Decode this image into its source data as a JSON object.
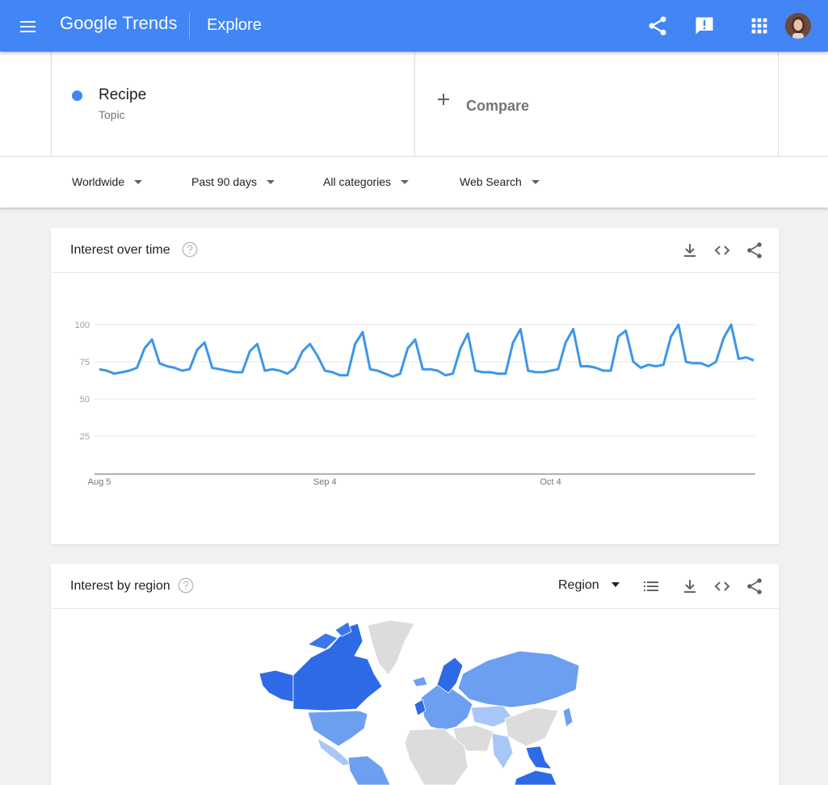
{
  "header": {
    "logo_google": "Google",
    "logo_trends": "Trends",
    "title": "Explore",
    "icons": [
      "menu-icon",
      "share-icon",
      "feedback-icon",
      "apps-icon",
      "avatar"
    ]
  },
  "search_terms": [
    {
      "name": "Recipe",
      "type": "Topic",
      "color": "#4285f4"
    }
  ],
  "compare": {
    "label": "Compare"
  },
  "filters": {
    "geo": "Worldwide",
    "time": "Past 90 days",
    "category": "All categories",
    "property": "Web Search"
  },
  "interest_over_time": {
    "title": "Interest over time"
  },
  "interest_by_region": {
    "title": "Interest by region",
    "resolution": "Region"
  },
  "colors": {
    "brand": "#4285f4",
    "line": "#3d96ea",
    "map_light": "#a8c7f8",
    "map_mid": "#6c9ff0",
    "map_dark": "#2f6ae6",
    "map_none": "#dcdcdc"
  },
  "chart_data": {
    "type": "line",
    "title": "",
    "xlabel": "",
    "ylabel": "",
    "ylim": [
      0,
      100
    ],
    "yticks": [
      25,
      50,
      75,
      100
    ],
    "x_tick_labels": [
      "Aug 5",
      "Sep 4",
      "Oct 4"
    ],
    "x_tick_index": [
      0,
      30,
      60
    ],
    "grid": true,
    "series": [
      {
        "values": [
          70,
          69,
          67,
          68,
          69,
          71,
          84,
          90,
          74,
          72,
          71,
          69,
          70,
          83,
          88,
          71,
          70,
          69,
          68,
          68,
          82,
          87,
          69,
          70,
          69,
          67,
          71,
          82,
          87,
          79,
          69,
          68,
          66,
          66,
          87,
          95,
          70,
          69,
          67,
          65,
          67,
          84,
          90,
          70,
          70,
          69,
          66,
          67,
          84,
          94,
          69,
          68,
          68,
          67,
          67,
          88,
          97,
          69,
          68,
          68,
          69,
          70,
          88,
          97,
          72,
          72,
          71,
          69,
          69,
          92,
          96,
          75,
          71,
          73,
          72,
          73,
          92,
          100,
          75,
          74,
          74,
          72,
          75,
          91,
          100,
          77,
          78,
          76
        ]
      }
    ]
  }
}
